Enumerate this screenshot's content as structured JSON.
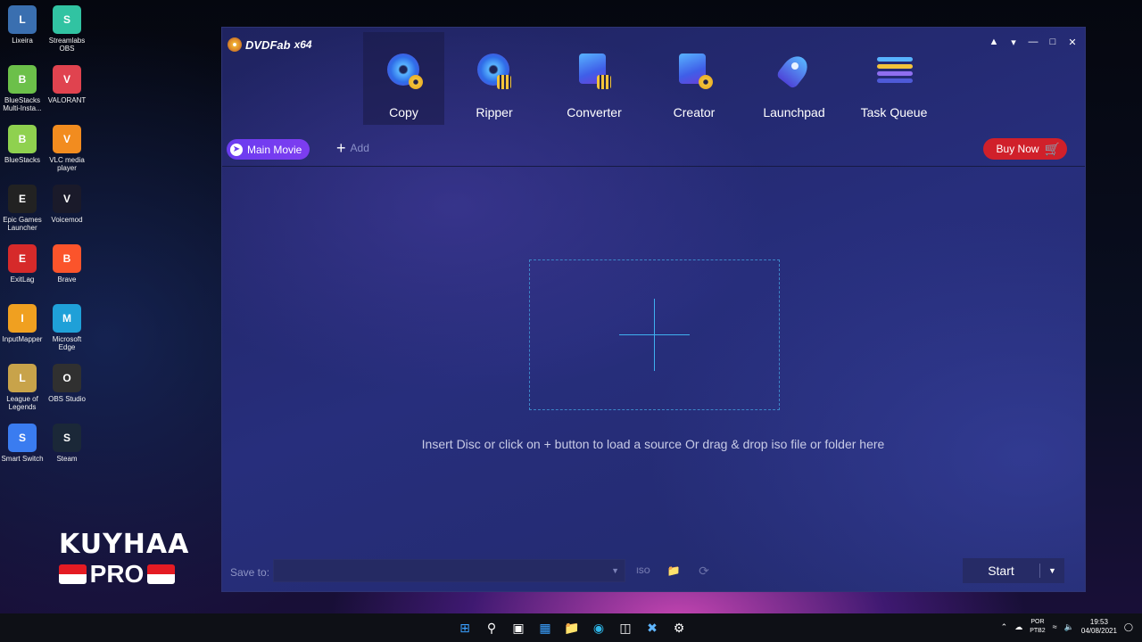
{
  "desktop": {
    "icons": [
      {
        "label": "Lixeira",
        "icon": "recycle-bin-icon",
        "color": "#3a6fb0"
      },
      {
        "label": "Streamlabs OBS",
        "icon": "streamlabs-icon",
        "color": "#31c3a2"
      },
      {
        "label": "BlueStacks Multi-Insta...",
        "icon": "bluestacks-multi-icon",
        "color": "#6cc04a"
      },
      {
        "label": "VALORANT",
        "icon": "valorant-icon",
        "color": "#e0434f"
      },
      {
        "label": "BlueStacks",
        "icon": "bluestacks-icon",
        "color": "#8fd14f"
      },
      {
        "label": "VLC media player",
        "icon": "vlc-icon",
        "color": "#f28c1f"
      },
      {
        "label": "Epic Games Launcher",
        "icon": "epic-games-icon",
        "color": "#222222"
      },
      {
        "label": "Voicemod",
        "icon": "voicemod-icon",
        "color": "#1a1a2a"
      },
      {
        "label": "ExitLag",
        "icon": "exitlag-icon",
        "color": "#d62a2a"
      },
      {
        "label": "Brave",
        "icon": "brave-icon",
        "color": "#fb542b"
      },
      {
        "label": "InputMapper",
        "icon": "inputmapper-icon",
        "color": "#f0a020"
      },
      {
        "label": "Microsoft Edge",
        "icon": "edge-icon",
        "color": "#1fa0d8"
      },
      {
        "label": "League of Legends",
        "icon": "league-icon",
        "color": "#c8a34a"
      },
      {
        "label": "OBS Studio",
        "icon": "obs-icon",
        "color": "#303030"
      },
      {
        "label": "Smart Switch",
        "icon": "smart-switch-icon",
        "color": "#3a7cf0"
      },
      {
        "label": "Steam",
        "icon": "steam-icon",
        "color": "#1b2838"
      }
    ]
  },
  "watermark": {
    "line1": "KUYHAA",
    "line2": "PRO"
  },
  "app": {
    "brand": "DVDFab",
    "arch": "x64",
    "window_controls": [
      "skin-icon",
      "menu-icon",
      "minimize-icon",
      "maximize-icon",
      "close-icon"
    ],
    "modules": [
      {
        "label": "Copy",
        "icon": "copy-disc-icon",
        "active": true
      },
      {
        "label": "Ripper",
        "icon": "ripper-icon",
        "active": false
      },
      {
        "label": "Converter",
        "icon": "converter-icon",
        "active": false
      },
      {
        "label": "Creator",
        "icon": "creator-icon",
        "active": false
      },
      {
        "label": "Launchpad",
        "icon": "launchpad-rocket-icon",
        "active": false
      },
      {
        "label": "Task Queue",
        "icon": "task-queue-icon",
        "active": false
      }
    ],
    "mode_button": "Main Movie",
    "add_label": "Add",
    "buy_label": "Buy Now",
    "drop_hint": "Insert Disc or click on + button to load a source Or drag & drop iso file or folder here",
    "save_to_label": "Save to:",
    "save_to_value": "",
    "iso_label": "ISO",
    "start_label": "Start",
    "colors": {
      "accent": "#7d3df0",
      "buy": "#d0202a",
      "dropzone": "#3fb0f0"
    }
  },
  "taskbar": {
    "apps": [
      "windows-start-icon",
      "search-icon",
      "task-view-icon",
      "widgets-icon",
      "file-explorer-icon",
      "edge-icon",
      "store-icon",
      "xbox-icon",
      "settings-icon"
    ],
    "lang_top": "POR",
    "lang_bottom": "PTB2",
    "time": "19:53",
    "date": "04/08/2021"
  }
}
